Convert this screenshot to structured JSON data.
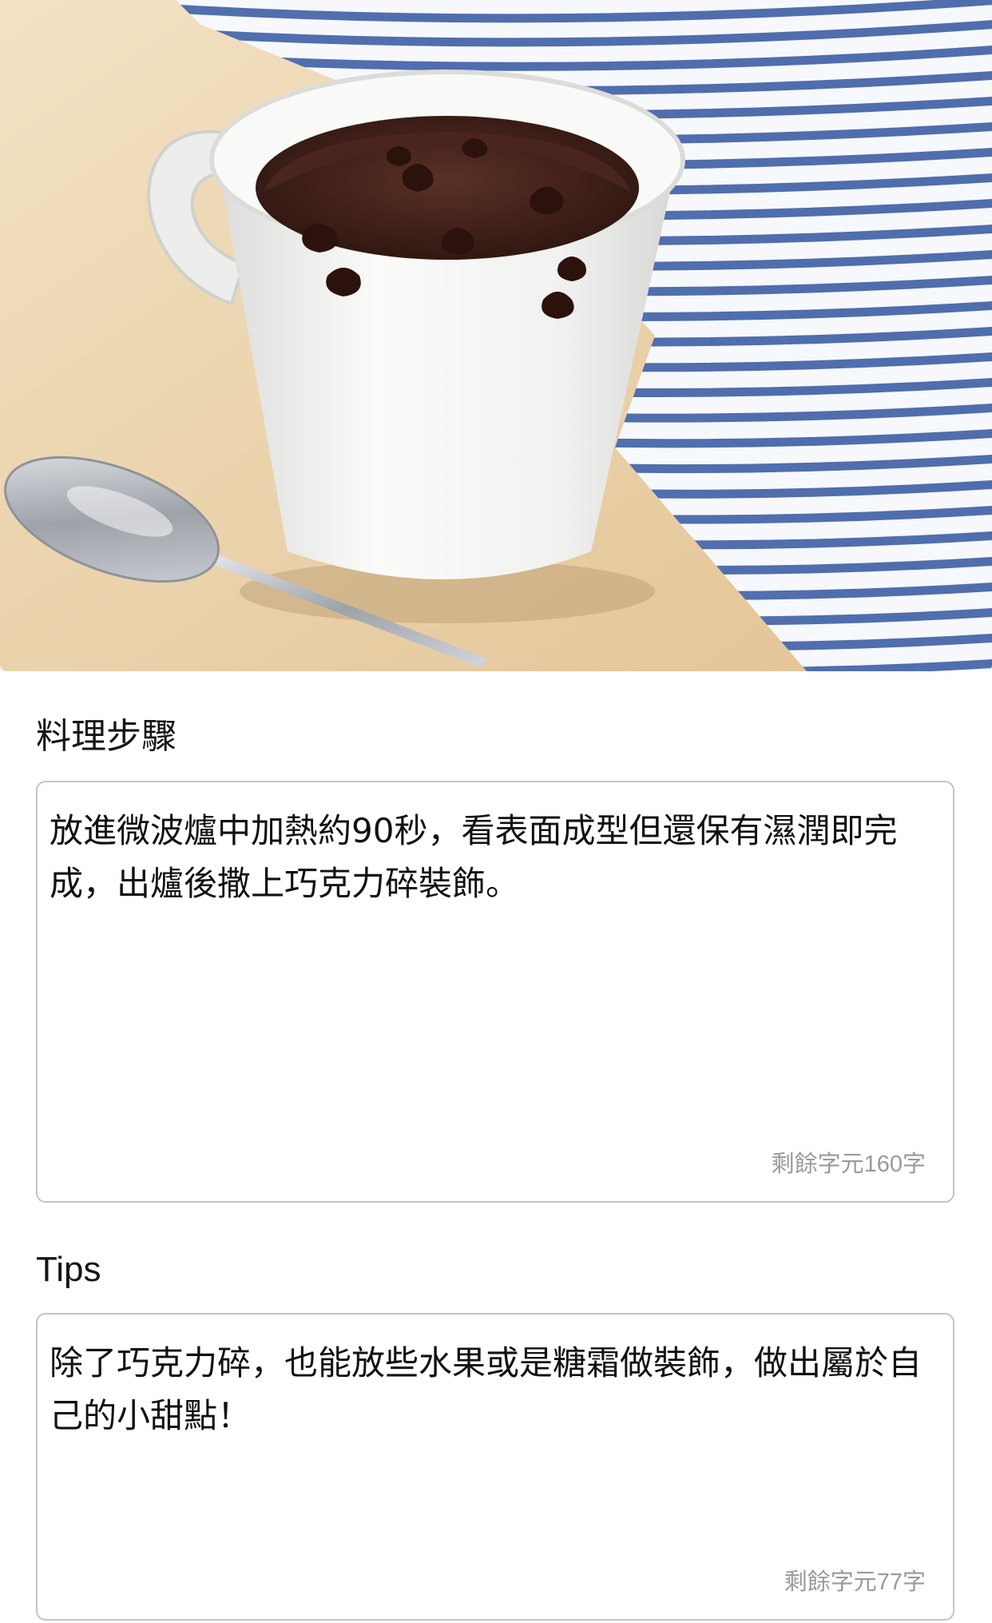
{
  "hero": {
    "image": "chocolate-mug-cake-photo",
    "colors": {
      "table": "#ecd3ac",
      "cloth_stripe": "#3f5fa6",
      "mug": "#f5f5f3",
      "cake": "#3b1d17",
      "chocolate_chip": "#2b120d",
      "spoon": "#b9bcc2"
    }
  },
  "steps": {
    "label": "料理步驟",
    "text": "放進微波爐中加熱約90秒，看表面成型但還保有濕潤即完成，出爐後撒上巧克力碎裝飾。",
    "counter": "剩餘字元160字"
  },
  "tips": {
    "label": "Tips",
    "text": "除了巧克力碎，也能放些水果或是糖霜做裝飾，做出屬於自己的小甜點！",
    "counter": "剩餘字元77字"
  }
}
